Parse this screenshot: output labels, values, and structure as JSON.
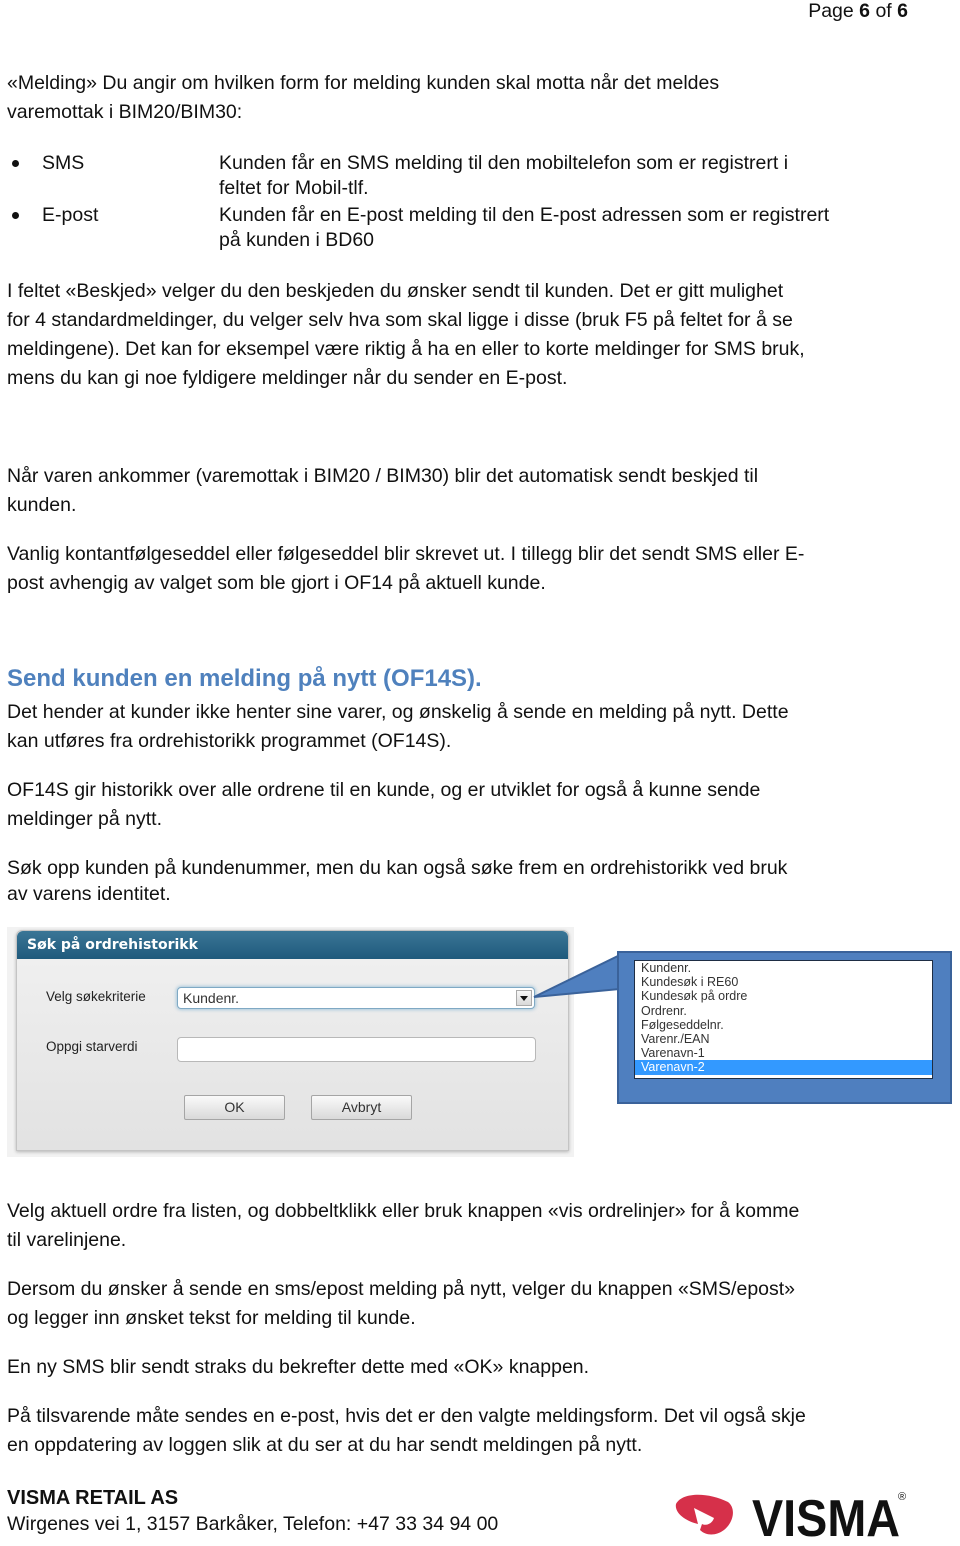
{
  "page": {
    "label": "Page",
    "current": "6",
    "of": "of",
    "total": "6"
  },
  "intro": {
    "line1": "«Melding» Du angir om hvilken form for melding kunden skal motta når det meldes",
    "line2": "varemottak i BIM20/BIM30:"
  },
  "bullets": [
    {
      "term": "SMS",
      "desc_line1": "Kunden får en SMS melding til den mobiltelefon som er registrert i",
      "desc_line2": "feltet for Mobil-tlf."
    },
    {
      "term": "E-post",
      "desc_line1": "Kunden får en E-post melding til den E-post adressen som er registrert",
      "desc_line2": "på kunden i BD60"
    }
  ],
  "paragraphs": {
    "beskjed": [
      "I feltet «Beskjed» velger du den beskjeden du ønsker sendt til kunden. Det er gitt mulighet",
      "for 4 standardmeldinger, du velger selv hva som skal ligge i disse (bruk F5 på feltet for å se",
      "meldingene). Det kan for eksempel være riktig å ha en eller to korte meldinger for SMS bruk,",
      "mens du kan gi noe fyldigere meldinger når du sender en E-post."
    ],
    "ankommer": [
      "Når varen ankommer (varemottak i BIM20 / BIM30) blir det automatisk sendt beskjed til",
      "kunden."
    ],
    "vanlig": [
      "Vanlig kontantfølgeseddel eller følgeseddel blir skrevet ut. I tillegg blir det sendt SMS eller E-",
      "post avhengig av valget som ble gjort i OF14 på aktuell kunde."
    ],
    "heading": "Send kunden en melding på nytt (OF14S).",
    "hender": [
      "Det hender at kunder ikke henter sine varer, og ønskelig å sende en melding på nytt. Dette",
      "kan utføres fra ordrehistorikk programmet (OF14S)."
    ],
    "of14s": [
      "OF14S gir historikk over alle ordrene til en kunde, og er utviklet for også å kunne sende",
      "meldinger på nytt."
    ],
    "sok": [
      "Søk opp kunden på kundenummer, men du kan også søke frem en ordrehistorikk ved bruk",
      "av varens identitet."
    ],
    "velg": [
      "Velg aktuell ordre fra listen, og dobbeltklikk eller bruk knappen «vis ordrelinjer» for å komme",
      "til varelinjene."
    ],
    "dersom": [
      "Dersom du ønsker å sende en sms/epost melding på nytt, velger du knappen «SMS/epost»",
      "og legger inn ønsket tekst for melding til kunde."
    ],
    "ny_sms": [
      "En ny SMS blir sendt straks du bekrefter dette med «OK» knappen."
    ],
    "tilsvarende": [
      "På tilsvarende måte sendes en e-post, hvis det er den valgte meldingsform. Det vil også skje",
      "en oppdatering av loggen slik at du ser at du har sendt meldingen på nytt."
    ]
  },
  "dialog": {
    "title": "Søk på ordrehistorikk",
    "criteria_label": "Velg søkekriterie",
    "criteria_value": "Kundenr.",
    "start_label": "Oppgi starverdi",
    "start_value": "",
    "ok_label": "OK",
    "cancel_label": "Avbryt",
    "title_color": "#1f5a7c"
  },
  "dropdown": {
    "options": [
      "Kundenr.",
      "Kundesøk i RE60",
      "Kundesøk på ordre",
      "Ordrenr.",
      "Følgeseddelnr.",
      "Varenr./EAN",
      "Varenavn-1",
      "Varenavn-2"
    ],
    "selected": "Varenavn-2",
    "callout_color": "#4f7fbf",
    "highlight_color": "#3399ff"
  },
  "footer": {
    "company": "VISMA RETAIL AS",
    "address": "Wirgenes vei 1, 3157 Barkåker, Telefon: +47 33 34 94 00",
    "logo_text": "VISMA",
    "logo_registered": "®",
    "logo_color": "#d6304a"
  },
  "colors": {
    "heading": "#4f81bd",
    "text": "#111111"
  }
}
